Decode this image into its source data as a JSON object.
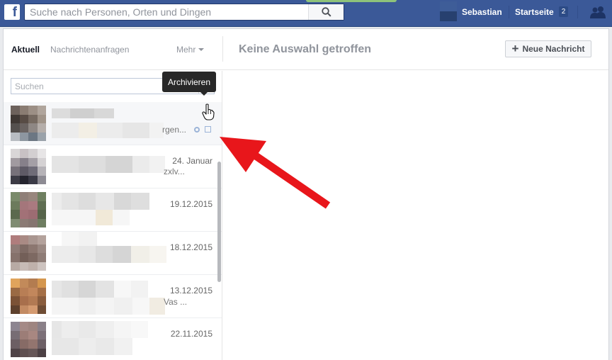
{
  "topbar": {
    "logo": "f",
    "search_placeholder": "Suche nach Personen, Orten und Dingen",
    "user_name": "Sebastian",
    "home_label": "Startseite",
    "home_count": "2"
  },
  "inbox": {
    "tabs": {
      "active": "Aktuell",
      "requests": "Nachrichtenanfragen",
      "more": "Mehr"
    },
    "no_selection": "Keine Auswahl getroffen",
    "new_message": "Neue Nachricht",
    "search_placeholder": "Suchen",
    "tooltip": "Archivieren",
    "threads": [
      {
        "date": "",
        "snippet": "rgen..."
      },
      {
        "date": "24. Januar",
        "snippet": "zxlv..."
      },
      {
        "date": "19.12.2015",
        "snippet": ""
      },
      {
        "date": "18.12.2015",
        "snippet": ""
      },
      {
        "date": "13.12.2015",
        "snippet": "Vas ..."
      },
      {
        "date": "22.11.2015",
        "snippet": ""
      }
    ]
  },
  "colors": {
    "brand_blue": "#3b5998",
    "annotation_red": "#e8161b"
  }
}
